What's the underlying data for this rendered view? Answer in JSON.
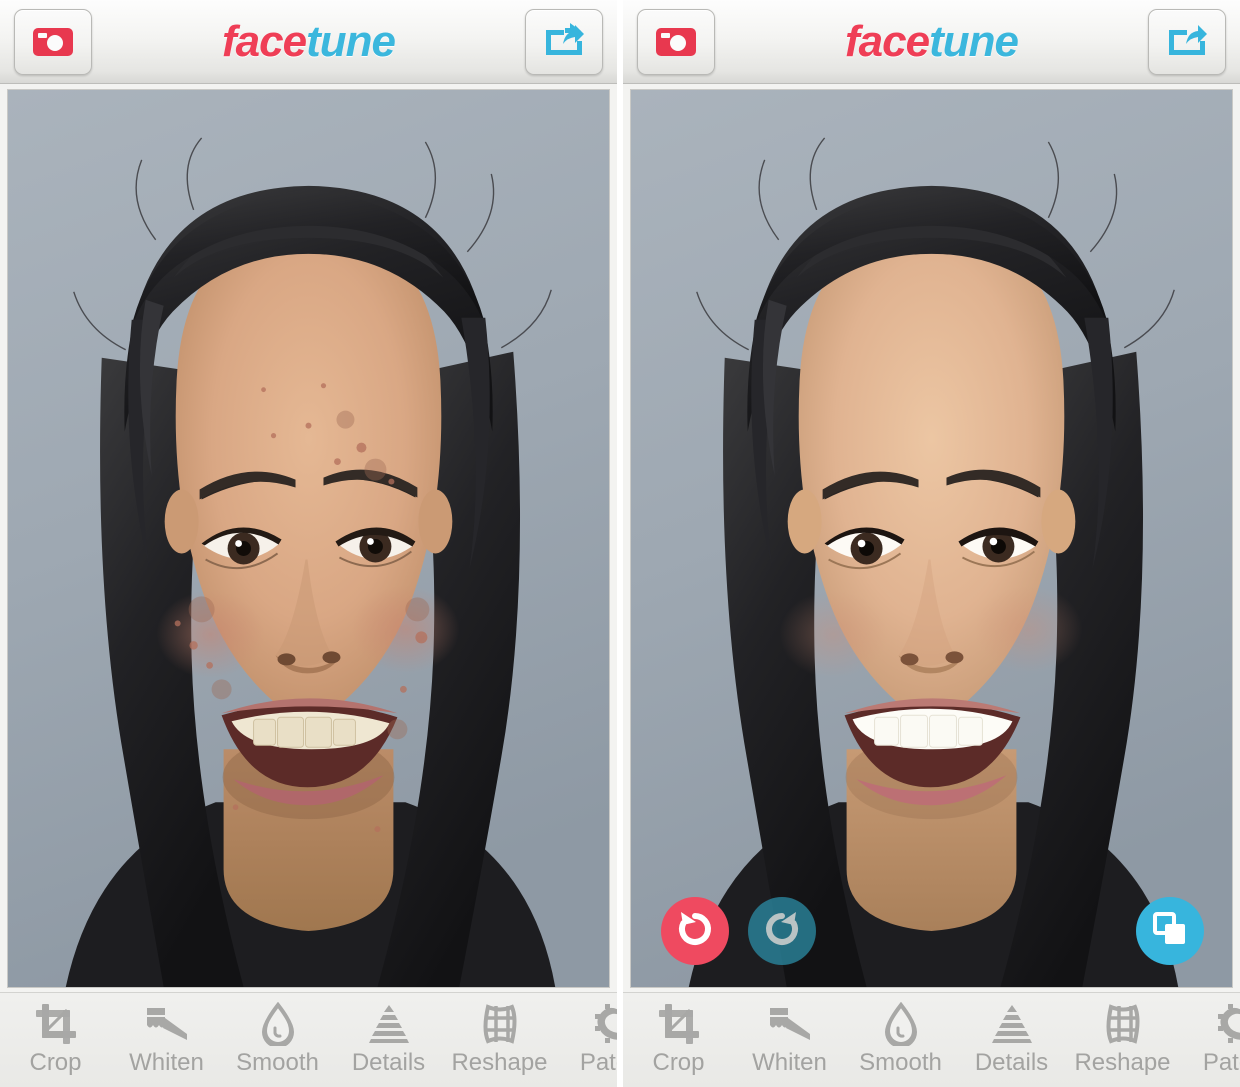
{
  "app": {
    "name": "Facetune",
    "logo_part1": "face",
    "logo_part2": "tune",
    "logo_color_1": "#ef3e56",
    "logo_color_2": "#3bb7dd"
  },
  "header": {
    "camera_button_label": "camera-button",
    "share_button_label": "share-button",
    "camera_icon": "camera-icon",
    "share_icon": "share-export-icon",
    "background": "#f1f1ef"
  },
  "panels": [
    {
      "id": "before",
      "caption": "Original photo",
      "photo_background": "#9aa4ae",
      "has_floating_buttons": false
    },
    {
      "id": "after",
      "caption": "Retouched photo",
      "photo_background": "#9aa4ae",
      "has_floating_buttons": true
    }
  ],
  "floating_buttons": [
    {
      "name": "undo-button",
      "icon": "undo-icon",
      "color": "#ef4a60",
      "enabled": true
    },
    {
      "name": "redo-button",
      "icon": "redo-icon",
      "color": "#2a88a0",
      "enabled": false
    },
    {
      "name": "compare-button",
      "icon": "compare-icon",
      "color": "#37b5dd",
      "enabled": true
    }
  ],
  "toolbar": {
    "background": "#ececea",
    "label_color": "#a3a3a1",
    "items": [
      {
        "label": "Crop",
        "icon": "crop-icon"
      },
      {
        "label": "Whiten",
        "icon": "whiten-teeth-icon"
      },
      {
        "label": "Smooth",
        "icon": "smooth-droplet-icon"
      },
      {
        "label": "Details",
        "icon": "details-pyramid-icon"
      },
      {
        "label": "Reshape",
        "icon": "reshape-grid-icon"
      },
      {
        "label": "Patch",
        "icon": "patch-icon"
      }
    ]
  }
}
